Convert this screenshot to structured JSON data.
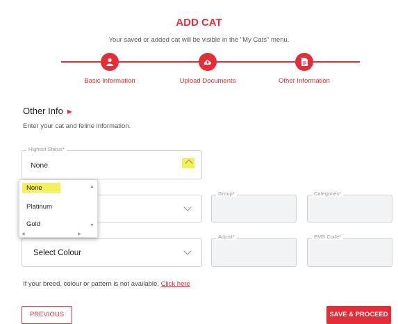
{
  "header": {
    "title": "ADD CAT",
    "subtitle": "Your saved or added cat will be visible in the \"My Cats\" menu."
  },
  "steps": [
    {
      "label": "Basic Information",
      "icon": "person-icon"
    },
    {
      "label": "Upload Documents",
      "icon": "cloud-upload-icon"
    },
    {
      "label": "Other Information",
      "icon": "document-icon"
    }
  ],
  "section": {
    "title": "Other Info",
    "subtitle": "Enter your cat and feline information."
  },
  "fields": {
    "highest_status": {
      "label": "Highest Status*",
      "value": "None"
    },
    "group": {
      "label": "Group*"
    },
    "categories": {
      "label": "Categories*"
    },
    "adjust": {
      "label": "Adjust*"
    },
    "ems_code": {
      "label": "EMS Code*"
    },
    "colour": {
      "placeholder": "Select Colour"
    }
  },
  "dropdown": {
    "options": [
      "None",
      "Platinum",
      "Gold"
    ],
    "selected": "None"
  },
  "note": {
    "text": "If your breed, colour or pattern is not available.",
    "link": "Click here"
  },
  "buttons": {
    "previous": "PREVIOUS",
    "save": "SAVE & PROCEED"
  },
  "colors": {
    "accent": "#e42d36",
    "highlight": "#f3f05a"
  }
}
